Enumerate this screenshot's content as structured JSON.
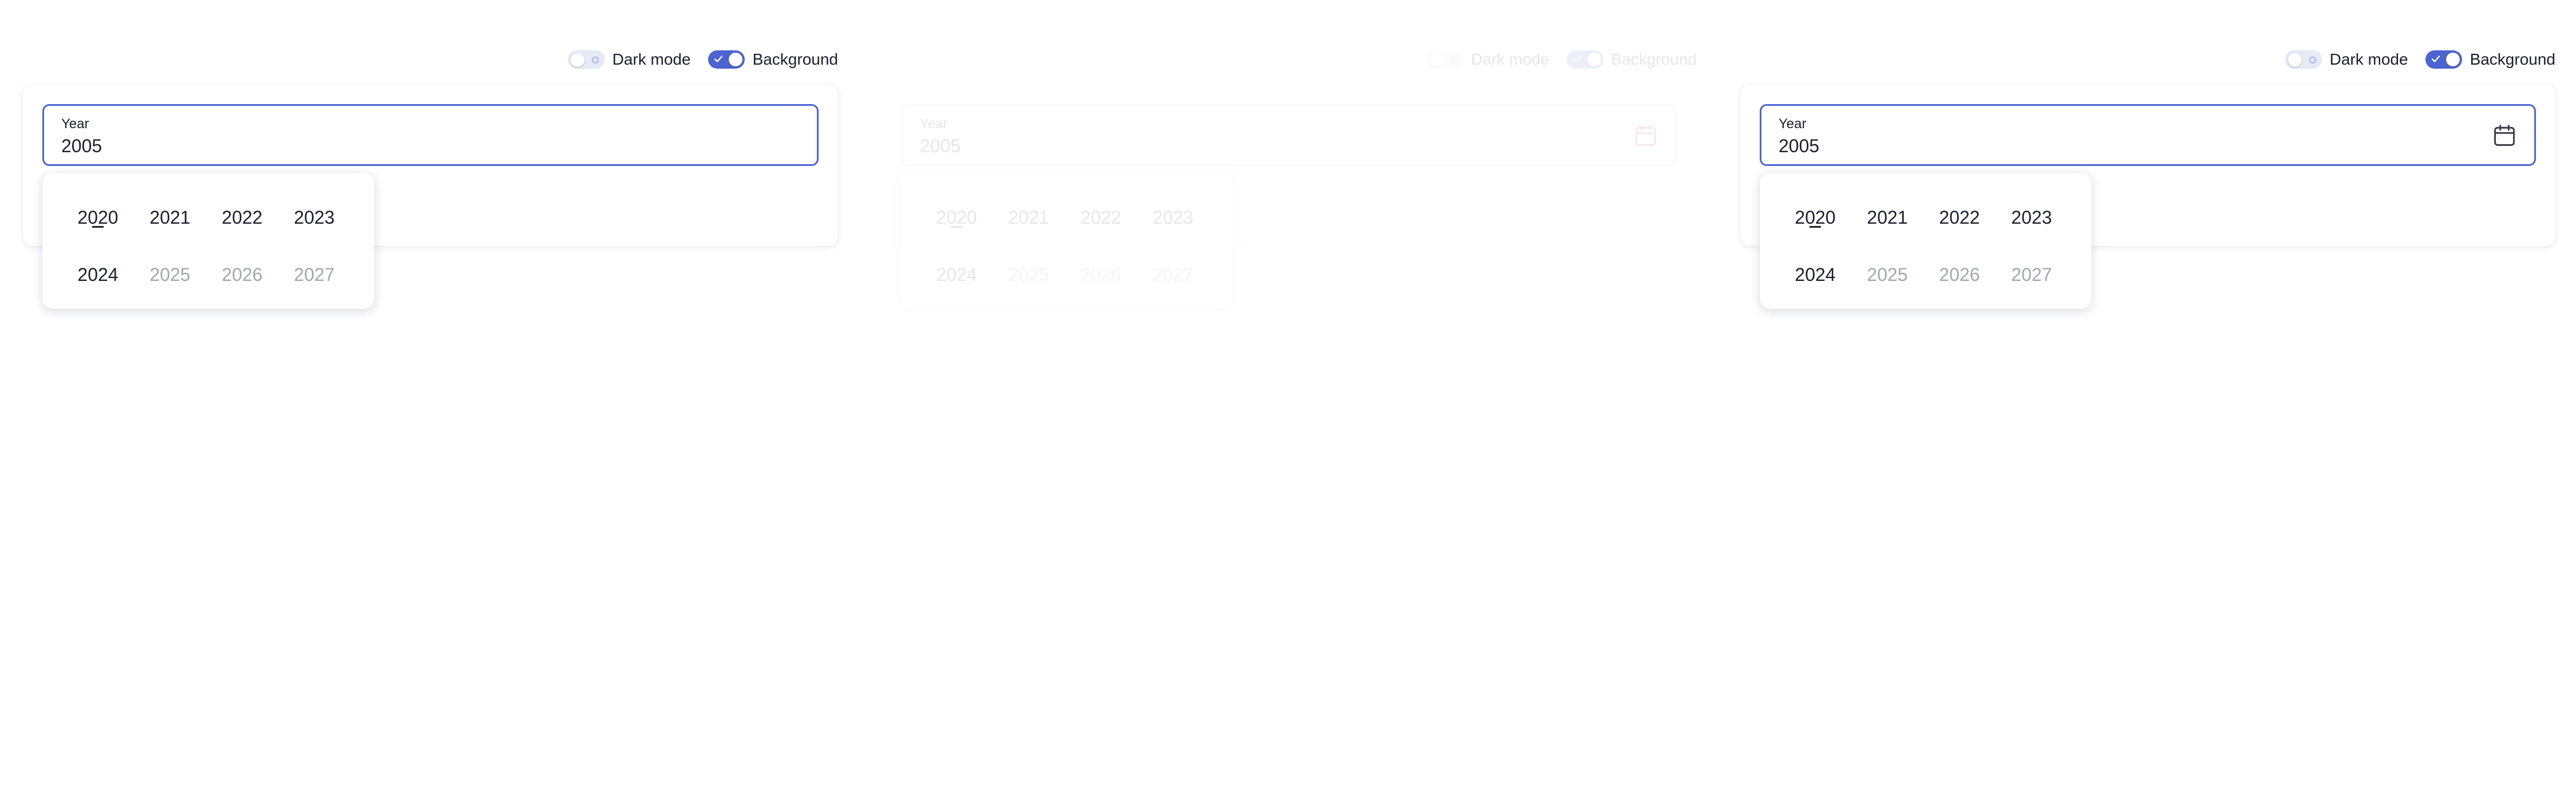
{
  "toolbar": {
    "dark_mode_label": "Dark mode",
    "dark_mode_on": false,
    "background_label": "Background",
    "background_on": true
  },
  "panels": [
    {
      "field_label": "Year",
      "field_value": "2005",
      "show_calendar_icon": false,
      "years": [
        "2020",
        "2021",
        "2022",
        "2023",
        "2024",
        "2025",
        "2026",
        "2027"
      ]
    },
    {
      "field_label": "Year",
      "field_value": "2005",
      "show_calendar_icon": true,
      "calendar_icon_color": "#d32f2f",
      "years": [
        "2020",
        "2021",
        "2022",
        "2023",
        "2024",
        "2025",
        "2026",
        "2027"
      ]
    },
    {
      "field_label": "Year",
      "field_value": "2005",
      "show_calendar_icon": true,
      "calendar_icon_color": "#3a3d4a",
      "years": [
        "2020",
        "2021",
        "2022",
        "2023",
        "2024",
        "2025",
        "2026",
        "2027"
      ]
    }
  ],
  "year_states": {
    "current": "2020",
    "disabled": [
      "2025",
      "2026",
      "2027"
    ]
  },
  "colors": {
    "accent": "#4c63d2",
    "text": "#1c1f2e",
    "muted": "#a3a7b4",
    "error_icon": "#d32f2f"
  }
}
